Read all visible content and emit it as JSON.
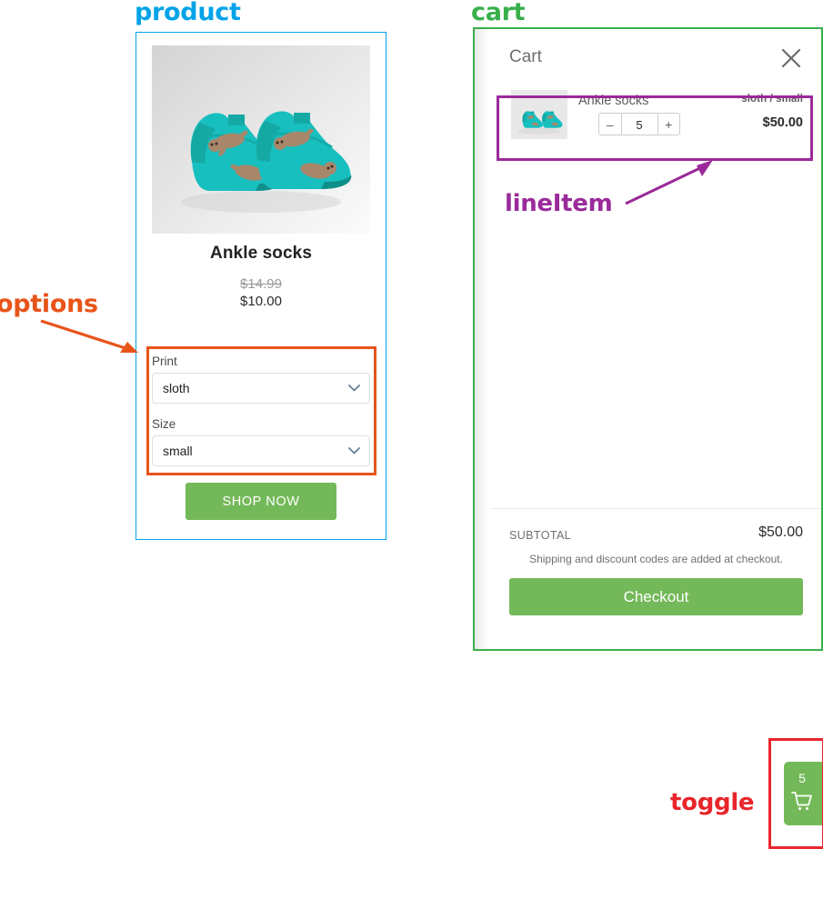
{
  "annotations": [
    {
      "id": "product",
      "label": "product",
      "color": "#00a3e8"
    },
    {
      "id": "cart",
      "label": "cart",
      "color": "#39af4b"
    },
    {
      "id": "options",
      "label": "options",
      "color": "#e8541a"
    },
    {
      "id": "lineItem",
      "label": "lineItem",
      "color": "#9a2a9a"
    },
    {
      "id": "toggle",
      "label": "toggle",
      "color": "#e8252b"
    }
  ],
  "product": {
    "image_alt": "teal ankle socks with sloth print",
    "title": "Ankle socks",
    "price_compare": "$14.99",
    "price_current": "$10.00",
    "options": [
      {
        "label": "Print",
        "value": "sloth",
        "icon": "chevron-down-icon"
      },
      {
        "label": "Size",
        "value": "small",
        "icon": "chevron-down-icon"
      }
    ],
    "cta_label": "SHOP NOW"
  },
  "cart": {
    "title": "Cart",
    "close_icon": "close-icon",
    "line_items": [
      {
        "title": "Ankle socks",
        "variant": "sloth / small",
        "price": "$50.00",
        "quantity": "5",
        "decrement_label": "–",
        "increment_label": "+",
        "thumb_alt": "teal ankle socks with sloth print"
      }
    ],
    "subtotal_label": "SUBTOTAL",
    "subtotal_value": "$50.00",
    "note": "Shipping and discount codes are added at checkout.",
    "checkout_label": "Checkout"
  },
  "toggle": {
    "count": "5",
    "icon": "shopping-cart-icon"
  },
  "colors": {
    "product_outline": "#00a3e8",
    "cart_outline": "#39af4b",
    "options_outline": "#e8541a",
    "lineitem_outline": "#9a2a9a",
    "toggle_outline": "#e8252b",
    "brand_green": "#74b959",
    "sock_teal": "#18bfbf"
  }
}
